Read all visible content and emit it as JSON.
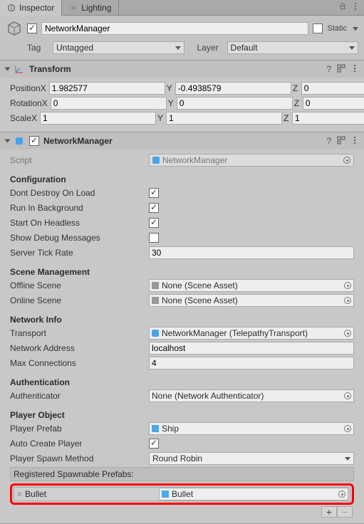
{
  "tabs": {
    "inspector": "Inspector",
    "lighting": "Lighting"
  },
  "header": {
    "name": "NetworkManager",
    "static_label": "Static",
    "tag_label": "Tag",
    "tag_value": "Untagged",
    "layer_label": "Layer",
    "layer_value": "Default"
  },
  "transform": {
    "title": "Transform",
    "position_label": "Position",
    "rotation_label": "Rotation",
    "scale_label": "Scale",
    "pos": {
      "x": "1.982577",
      "y": "-0.4938579",
      "z": "0"
    },
    "rot": {
      "x": "0",
      "y": "0",
      "z": "0"
    },
    "scale": {
      "x": "1",
      "y": "1",
      "z": "1"
    },
    "axis": {
      "x": "X",
      "y": "Y",
      "z": "Z"
    }
  },
  "nm": {
    "title": "NetworkManager",
    "script_label": "Script",
    "script_value": "NetworkManager",
    "config_head": "Configuration",
    "dont_destroy": "Dont Destroy On Load",
    "run_bg": "Run In Background",
    "start_headless": "Start On Headless",
    "show_debug": "Show Debug Messages",
    "tick_label": "Server Tick Rate",
    "tick_value": "30",
    "scene_head": "Scene Management",
    "offline_label": "Offline Scene",
    "online_label": "Online Scene",
    "none_scene": "None (Scene Asset)",
    "net_head": "Network Info",
    "transport_label": "Transport",
    "transport_value": "NetworkManager (TelepathyTransport)",
    "address_label": "Network Address",
    "address_value": "localhost",
    "maxconn_label": "Max Connections",
    "maxconn_value": "4",
    "auth_head": "Authentication",
    "authenticator_label": "Authenticator",
    "authenticator_value": "None (Network Authenticator)",
    "player_head": "Player Object",
    "player_prefab_label": "Player Prefab",
    "player_prefab_value": "Ship",
    "autocreate_label": "Auto Create Player",
    "spawn_method_label": "Player Spawn Method",
    "spawn_method_value": "Round Robin",
    "reg_prefabs_label": "Registered Spawnable Prefabs:",
    "bullet_label": "Bullet",
    "bullet_value": "Bullet",
    "plus": "+",
    "minus": "−"
  }
}
